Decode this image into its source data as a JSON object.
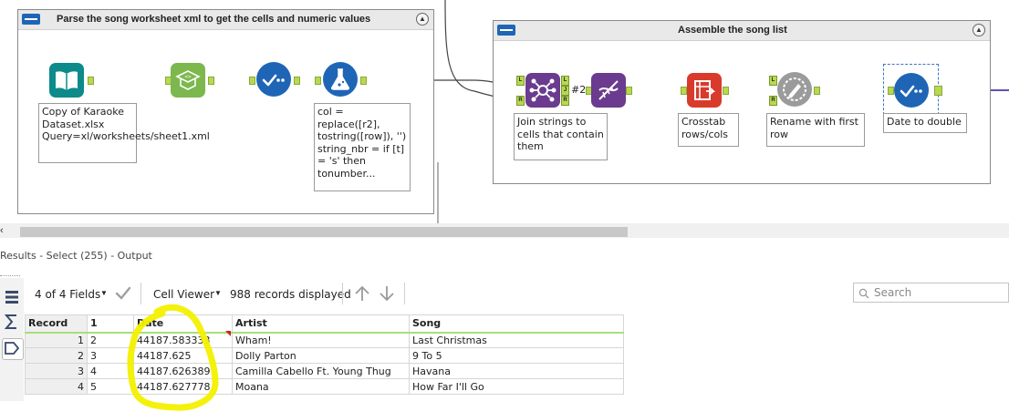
{
  "canvas": {
    "container1": {
      "title": "Parse the song worksheet xml to get the cells and numeric values",
      "input_annotation": "Copy of Karaoke Dataset.xlsx Query=xl/worksheets/sheet1.xml",
      "formula_annotation": "col = replace([r2], tostring([row]), '') string_nbr = if [t] = 's' then tonumber..."
    },
    "container2": {
      "title": "Assemble the song list",
      "join_badge": "#2",
      "join_annotation": "Join strings to cells that contain them",
      "crosstab_annotation": "Crosstab rows/cols",
      "rename_annotation": "Rename with first row",
      "date_annotation": "Date to double"
    },
    "anchors": {
      "left": "L",
      "join": "J",
      "right": "R"
    }
  },
  "results": {
    "title": "Results - Select (255) - Output",
    "fields_label": "4 of 4 Fields",
    "viewer_label": "Cell Viewer",
    "records_label": "988 records displayed",
    "search_placeholder": "Search",
    "columns": [
      "Record",
      "1",
      "Date",
      "Artist",
      "Song"
    ],
    "rows": [
      [
        "1",
        "2",
        "44187.583333",
        "Wham!",
        "Last Christmas"
      ],
      [
        "2",
        "3",
        "44187.625",
        "Dolly Parton",
        "9 To 5"
      ],
      [
        "3",
        "4",
        "44187.626389",
        "Camilla Cabello Ft. Young Thug",
        "Havana"
      ],
      [
        "4",
        "5",
        "44187.627778",
        "Moana",
        "How Far I'll Go"
      ]
    ]
  },
  "colors": {
    "annotation_highlight": "#f3f000",
    "tool_blue": "#1f65b6",
    "tool_green": "#7cb84e",
    "tool_teal": "#0d8a8a",
    "tool_purple": "#6a3b8f",
    "tool_red": "#d83b2b",
    "connector_green": "#2ea82e",
    "connector_purple": "#4a3aa8"
  },
  "icons": [
    "input-book-icon",
    "parse-icon",
    "select-check-icon",
    "formula-flask-icon",
    "join-icon",
    "dna-icon",
    "crosstab-icon",
    "dynamic-rename-icon",
    "select-check-icon"
  ]
}
